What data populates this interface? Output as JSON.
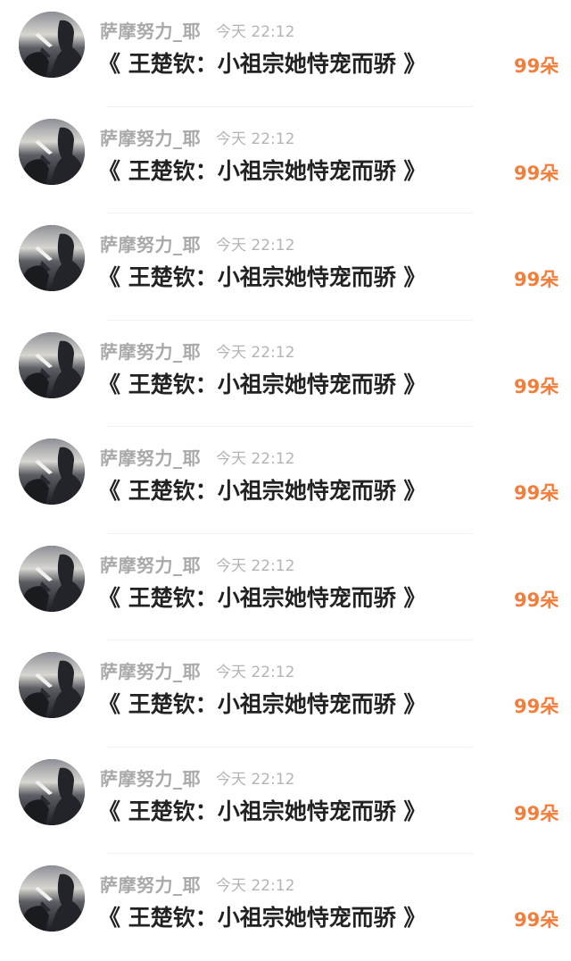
{
  "colors": {
    "username": "#a9a9a9",
    "time": "#b4b4b4",
    "title": "#222222",
    "reward": "#f37d3a",
    "divider": "#f0f0f0"
  },
  "messages": [
    {
      "user": "萨摩努力_耶",
      "time": "今天 22:12",
      "title": "《 王楚钦：小祖宗她恃宠而骄 》",
      "reward": "99朵",
      "avatar_icon": "avatar-silhouette-sunset-icon"
    },
    {
      "user": "萨摩努力_耶",
      "time": "今天 22:12",
      "title": "《 王楚钦：小祖宗她恃宠而骄 》",
      "reward": "99朵",
      "avatar_icon": "avatar-silhouette-sunset-icon"
    },
    {
      "user": "萨摩努力_耶",
      "time": "今天 22:12",
      "title": "《 王楚钦：小祖宗她恃宠而骄 》",
      "reward": "99朵",
      "avatar_icon": "avatar-silhouette-sunset-icon"
    },
    {
      "user": "萨摩努力_耶",
      "time": "今天 22:12",
      "title": "《 王楚钦：小祖宗她恃宠而骄 》",
      "reward": "99朵",
      "avatar_icon": "avatar-silhouette-sunset-icon"
    },
    {
      "user": "萨摩努力_耶",
      "time": "今天 22:12",
      "title": "《 王楚钦：小祖宗她恃宠而骄 》",
      "reward": "99朵",
      "avatar_icon": "avatar-silhouette-sunset-icon"
    },
    {
      "user": "萨摩努力_耶",
      "time": "今天 22:12",
      "title": "《 王楚钦：小祖宗她恃宠而骄 》",
      "reward": "99朵",
      "avatar_icon": "avatar-silhouette-sunset-icon"
    },
    {
      "user": "萨摩努力_耶",
      "time": "今天 22:12",
      "title": "《 王楚钦：小祖宗她恃宠而骄 》",
      "reward": "99朵",
      "avatar_icon": "avatar-silhouette-sunset-icon"
    },
    {
      "user": "萨摩努力_耶",
      "time": "今天 22:12",
      "title": "《 王楚钦：小祖宗她恃宠而骄 》",
      "reward": "99朵",
      "avatar_icon": "avatar-silhouette-sunset-icon"
    },
    {
      "user": "萨摩努力_耶",
      "time": "今天 22:12",
      "title": "《 王楚钦：小祖宗她恃宠而骄 》",
      "reward": "99朵",
      "avatar_icon": "avatar-silhouette-sunset-icon"
    }
  ]
}
